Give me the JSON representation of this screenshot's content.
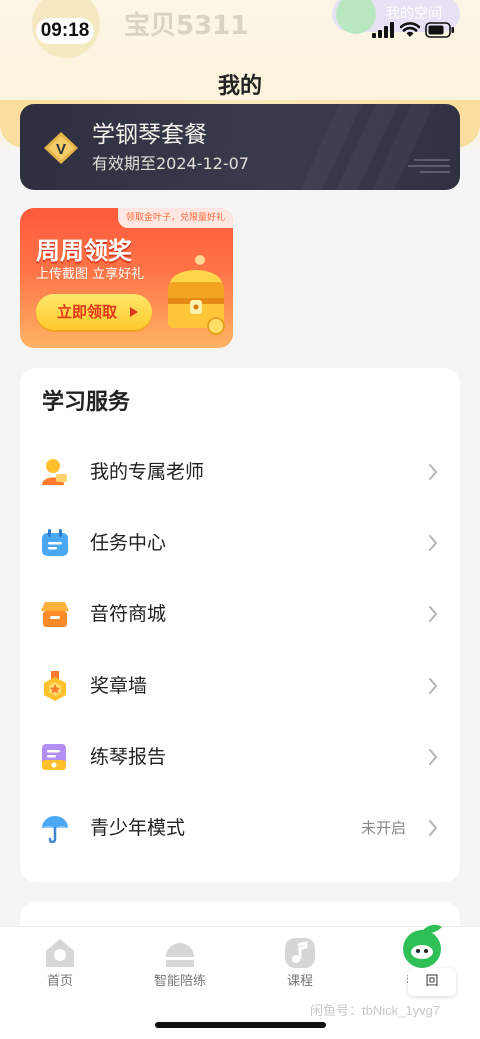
{
  "status_bar": {
    "time": "09:18",
    "icons": [
      "cellular-signal-icon",
      "wifi-icon",
      "battery-icon"
    ]
  },
  "header": {
    "nickname": "宝贝5311",
    "my_space": "我的空间",
    "title": "我的"
  },
  "vip_card": {
    "title": "学钢琴套餐",
    "expire": "有效期至2024-12-07"
  },
  "promo": {
    "tag": "领取金叶子，兑限量好礼",
    "title": "周周领奖",
    "subtitle": "上传截图 立享好礼",
    "button": "立即领取"
  },
  "services": {
    "title": "学习服务",
    "items": [
      {
        "label": "我的专属老师",
        "value": "",
        "icon": "teacher-icon"
      },
      {
        "label": "任务中心",
        "value": "",
        "icon": "calendar-task-icon"
      },
      {
        "label": "音符商城",
        "value": "",
        "icon": "shop-icon"
      },
      {
        "label": "奖章墙",
        "value": "",
        "icon": "medal-icon"
      },
      {
        "label": "练琴报告",
        "value": "",
        "icon": "report-icon"
      },
      {
        "label": "青少年模式",
        "value": "未开启",
        "icon": "umbrella-icon"
      }
    ]
  },
  "tabbar": {
    "tabs": [
      {
        "label": "首页",
        "icon": "home-icon"
      },
      {
        "label": "智能陪练",
        "icon": "practice-icon"
      },
      {
        "label": "课程",
        "icon": "course-icon"
      },
      {
        "label": "我的",
        "icon": "leaf-mine-icon",
        "active": true
      }
    ],
    "float_button": "回"
  },
  "watermark": "闲鱼号：tbNick_1yvg7",
  "colors": {
    "accent_orange": "#ff6a3d",
    "vip_dark": "#2d2f3f",
    "brand_green": "#2fbf57"
  }
}
